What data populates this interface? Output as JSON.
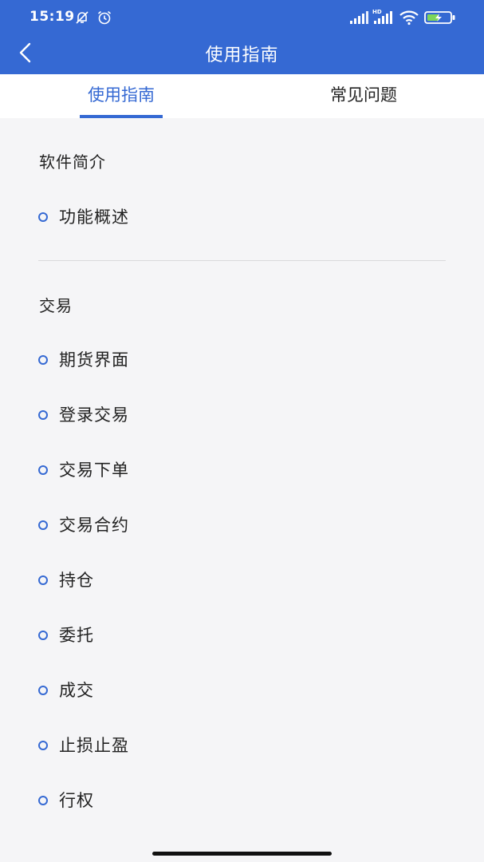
{
  "status_bar": {
    "time": "15:19",
    "icons": [
      "bell-muted-icon",
      "alarm-icon",
      "signal-icon",
      "hd-signal-icon",
      "wifi-icon",
      "battery-charging-icon"
    ]
  },
  "header": {
    "title": "使用指南",
    "back_icon": "chevron-left-icon"
  },
  "tabs": [
    {
      "label": "使用指南",
      "active": true
    },
    {
      "label": "常见问题",
      "active": false
    }
  ],
  "sections": [
    {
      "title": "软件简介",
      "items": [
        "功能概述"
      ]
    },
    {
      "title": "交易",
      "items": [
        "期货界面",
        "登录交易",
        "交易下单",
        "交易合约",
        "持仓",
        "委托",
        "成交",
        "止损止盈",
        "行权"
      ]
    }
  ],
  "colors": {
    "accent": "#3569d3",
    "background": "#f5f5f7",
    "text": "#222222"
  }
}
